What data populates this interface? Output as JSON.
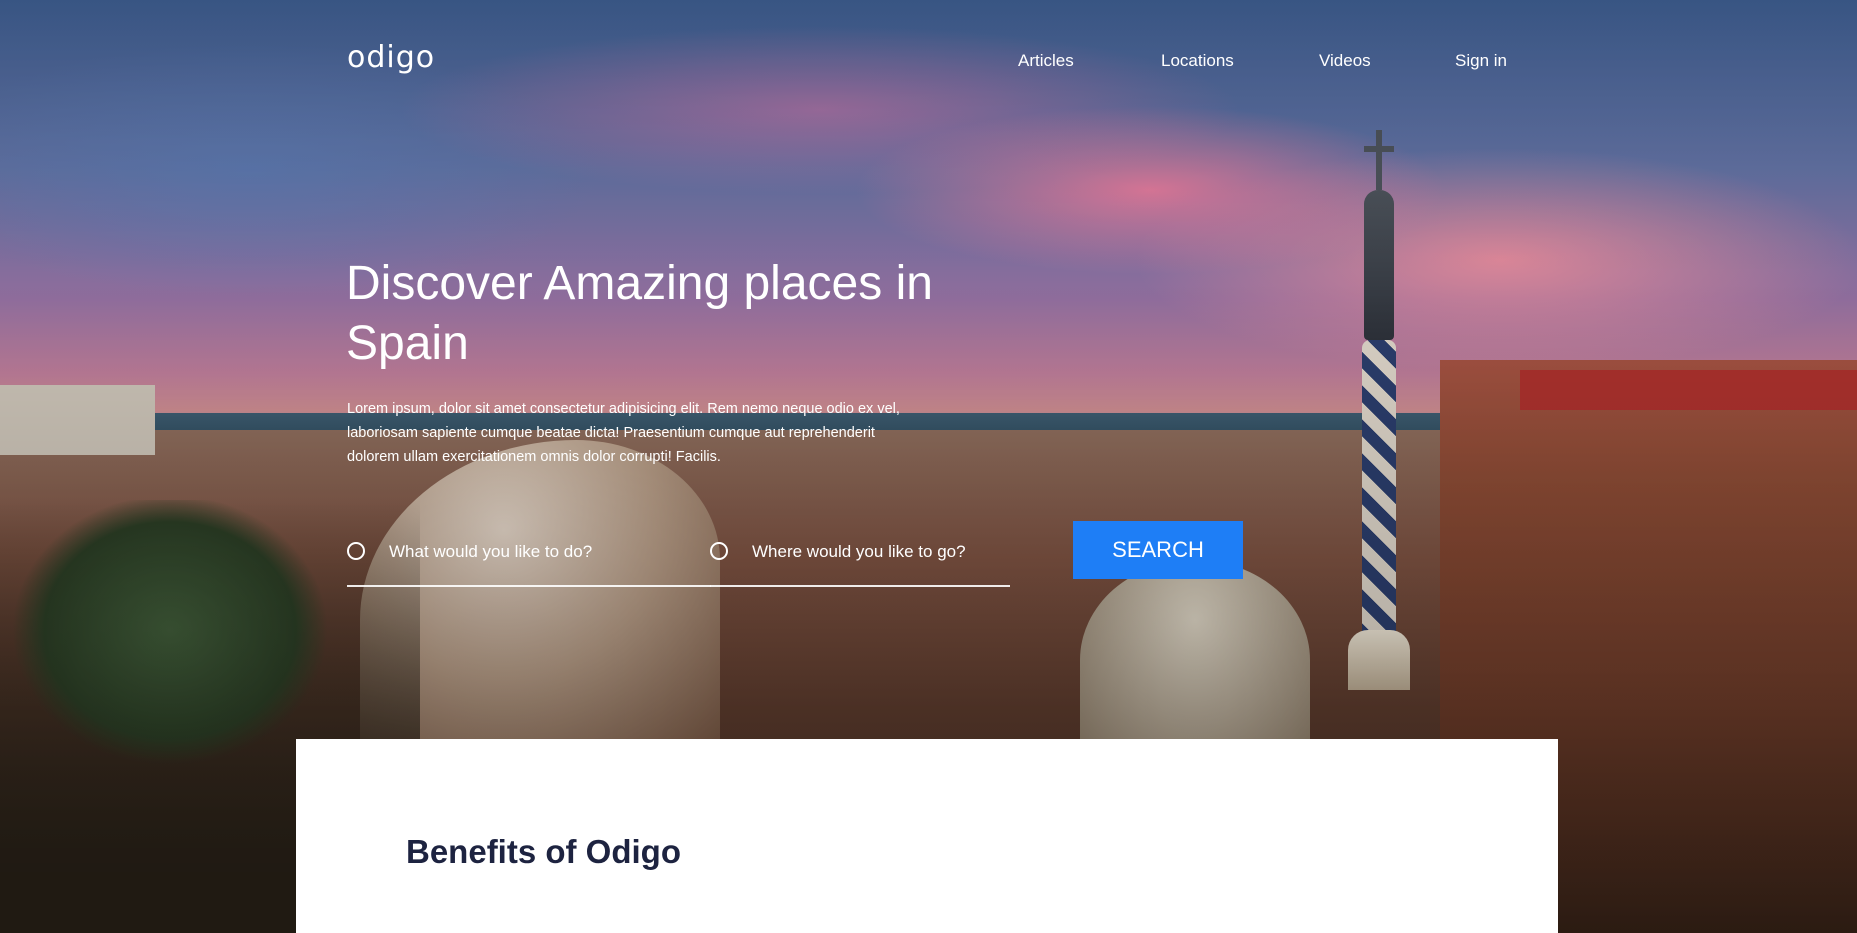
{
  "brand": {
    "logo": "odigo"
  },
  "nav": {
    "items": [
      "Articles",
      "Locations",
      "Videos",
      "Sign in"
    ]
  },
  "hero": {
    "headline": "Discover Amazing places in Spain",
    "lede": "Lorem ipsum, dolor sit amet consectetur adipisicing elit. Rem nemo neque odio ex vel, laboriosam sapiente cumque beatae dicta! Praesentium cumque aut reprehenderit dolorem ullam exercitationem omnis dolor corrupti! Facilis."
  },
  "search": {
    "what_placeholder": "What would you like to do?",
    "where_placeholder": "Where would you like to go?",
    "button_label": "SEARCH"
  },
  "benefits": {
    "title": "Benefits of Odigo"
  },
  "colors": {
    "accent": "#1e7ef6",
    "heading_dark": "#1d2340"
  }
}
